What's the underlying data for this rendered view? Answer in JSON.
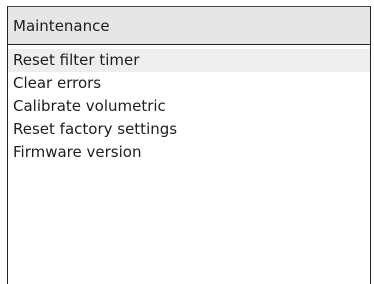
{
  "header": {
    "title": "Maintenance"
  },
  "menu": {
    "selected_index": 0,
    "items": [
      {
        "label": "Reset filter timer"
      },
      {
        "label": "Clear errors"
      },
      {
        "label": "Calibrate volumetric"
      },
      {
        "label": "Reset factory settings"
      },
      {
        "label": "Firmware version"
      }
    ]
  },
  "colors": {
    "header_bg": "#e6e6e6",
    "selected_bg": "#eeeeee",
    "border": "#222222",
    "text": "#1e1e1e"
  }
}
